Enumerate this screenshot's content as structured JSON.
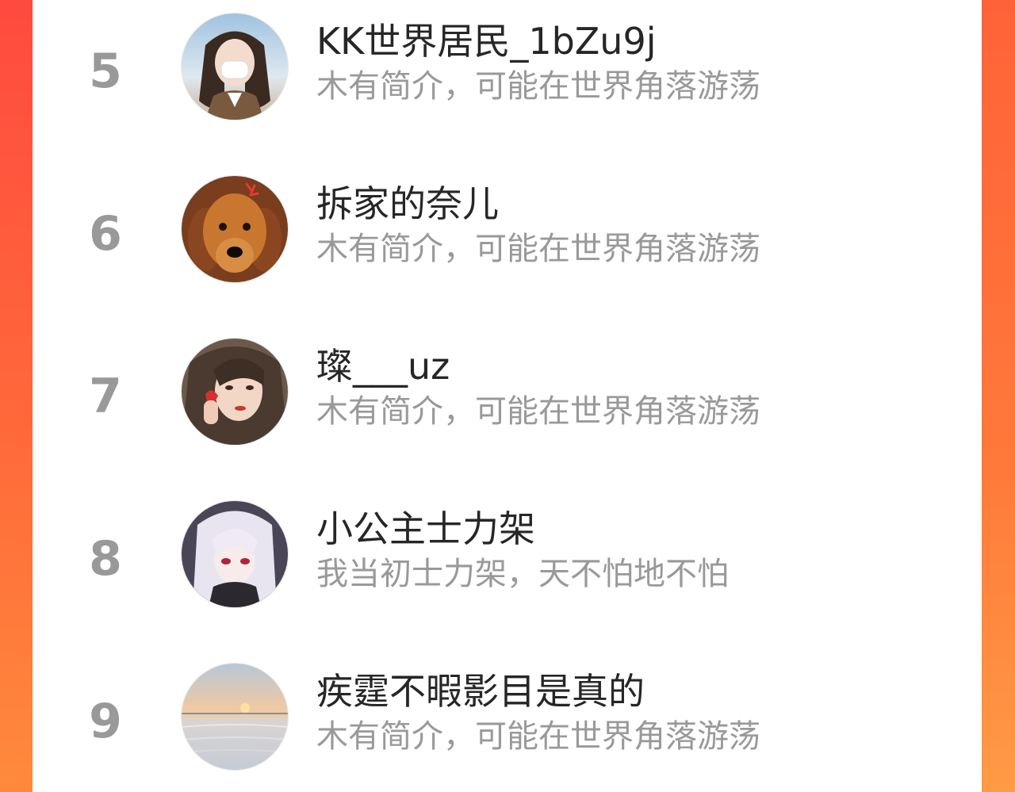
{
  "ranking": {
    "items": [
      {
        "rank": "5",
        "name": "KK世界居民_1bZu9j",
        "bio": "木有简介，可能在世界角落游荡",
        "avatar_icon": "girl-with-mask-avatar"
      },
      {
        "rank": "6",
        "name": "拆家的奈儿",
        "bio": "木有简介，可能在世界角落游荡",
        "avatar_icon": "golden-retriever-avatar"
      },
      {
        "rank": "7",
        "name": "璨___uz",
        "bio": "木有简介，可能在世界角落游荡",
        "avatar_icon": "girl-with-strawberry-avatar"
      },
      {
        "rank": "8",
        "name": "小公主士力架",
        "bio": "我当初士力架，天不怕地不怕",
        "avatar_icon": "anime-girl-avatar"
      },
      {
        "rank": "9",
        "name": "疾霆不暇影目是真的",
        "bio": "木有简介，可能在世界角落游荡",
        "avatar_icon": "sunset-sea-avatar"
      }
    ]
  },
  "colors": {
    "accent": "#ff4a3f",
    "accent_end": "#ff8a3c",
    "rank_gray": "#999999",
    "name_text": "#262626",
    "bio_text": "#999999"
  }
}
